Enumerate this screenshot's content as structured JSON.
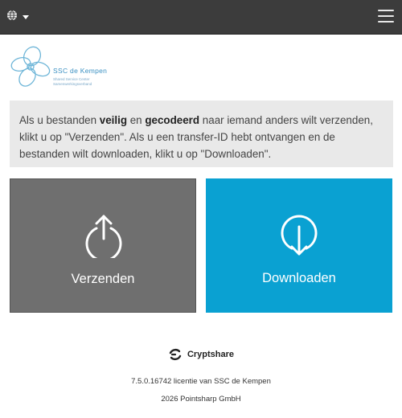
{
  "header": {
    "language_icon": "globe-icon",
    "menu_icon": "hamburger-menu-icon"
  },
  "logo": {
    "name": "SSC de Kempen",
    "sub_line1": "Shared Service Center",
    "sub_line2": "Samenwerkingsverband"
  },
  "info": {
    "part1": "Als u bestanden ",
    "bold1": "veilig",
    "part2": " en ",
    "bold2": "gecodeerd",
    "part3": " naar iemand anders wilt verzenden, klikt u op \"Verzenden\". Als u een transfer-ID hebt ontvangen en de bestanden wilt downloaden, klikt u op \"Downloaden\"."
  },
  "tiles": {
    "send_label": "Verzenden",
    "send_icon": "upload-icon",
    "download_label": "Downloaden",
    "download_icon": "download-icon"
  },
  "footer": {
    "brand": "Cryptshare",
    "license": "7.5.0.16742 licentie van SSC de Kempen",
    "copyright": "2026 Pointsharp GmbH"
  },
  "colors": {
    "topbar": "#3c3c3c",
    "send_tile": "#6f6f6f",
    "download_tile": "#0aa1d2",
    "info_bg": "#e9e9e9"
  }
}
